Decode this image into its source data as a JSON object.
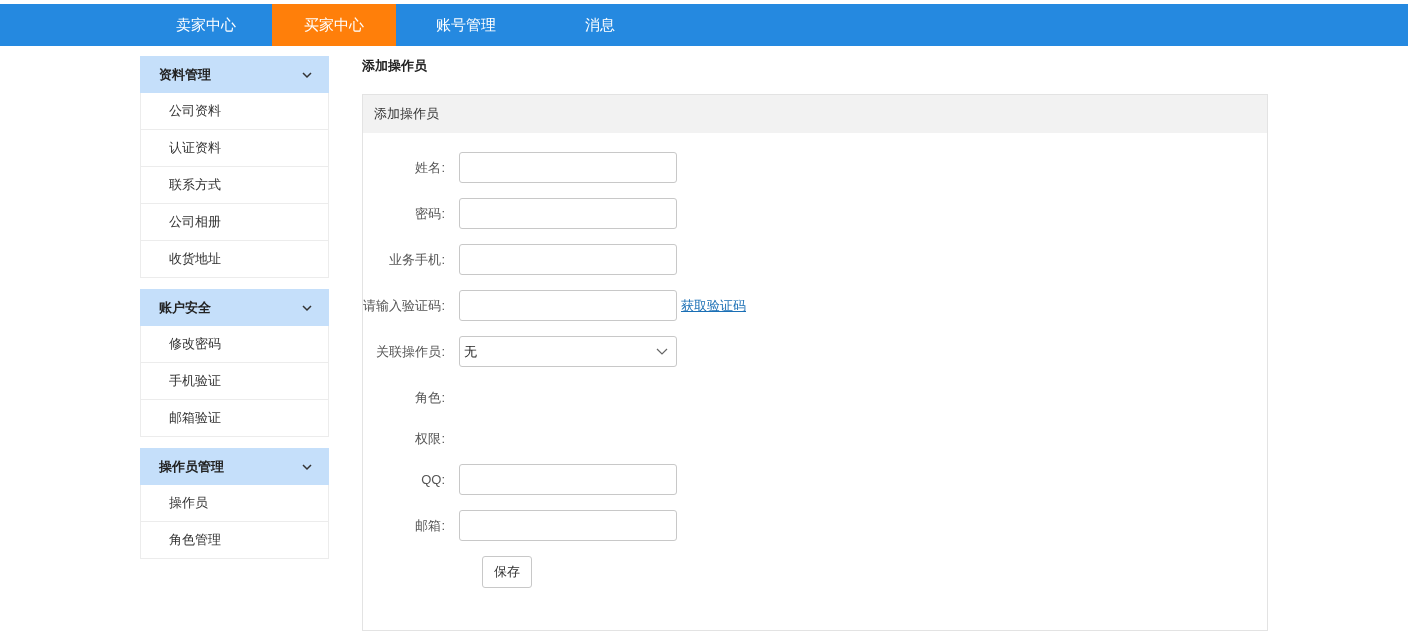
{
  "nav": [
    {
      "label": "卖家中心",
      "selected": false
    },
    {
      "label": "买家中心",
      "selected": true
    },
    {
      "label": "账号管理",
      "selected": false
    },
    {
      "label": "消息",
      "selected": false
    }
  ],
  "sidebar": [
    {
      "title": "资料管理",
      "expanded": true,
      "items": [
        "公司资料",
        "认证资料",
        "联系方式",
        "公司相册",
        "收货地址"
      ]
    },
    {
      "title": "账户安全",
      "expanded": true,
      "items": [
        "修改密码",
        "手机验证",
        "邮箱验证"
      ]
    },
    {
      "title": "操作员管理",
      "expanded": true,
      "items": [
        "操作员",
        "角色管理"
      ]
    }
  ],
  "page_title": "添加操作员",
  "panel": {
    "title": "添加操作员",
    "fields": [
      {
        "label": "姓名:",
        "kind": "input"
      },
      {
        "label": "密码:",
        "kind": "input"
      },
      {
        "label": "业务手机:",
        "kind": "input"
      },
      {
        "label": "请输入验证码:",
        "kind": "input",
        "link": "获取验证码"
      },
      {
        "label": "关联操作员:",
        "kind": "select",
        "value": "无"
      },
      {
        "label": "角色:",
        "kind": "static"
      },
      {
        "label": "权限:",
        "kind": "static"
      },
      {
        "label": "QQ:",
        "kind": "input"
      },
      {
        "label": "邮箱:",
        "kind": "input"
      }
    ],
    "submit": "保存"
  }
}
